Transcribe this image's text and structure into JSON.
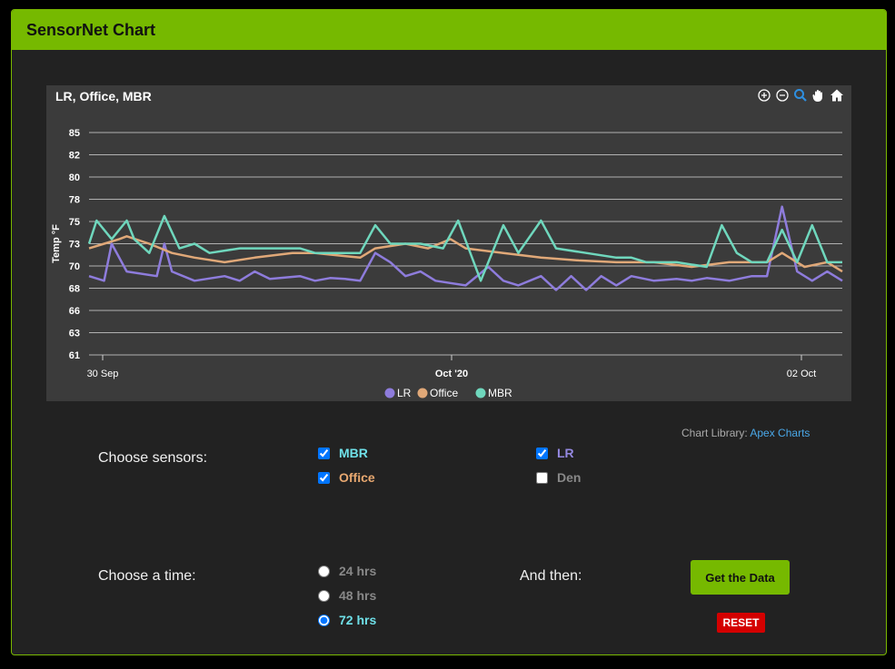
{
  "panel": {
    "title": "SensorNet Chart"
  },
  "chart_data": {
    "type": "line",
    "title": "LR, Office, MBR",
    "ylabel": "Temp °F",
    "xlabel": "",
    "y_ticks": [
      "85",
      "82",
      "80",
      "78",
      "75",
      "73",
      "70",
      "68",
      "66",
      "63",
      "61"
    ],
    "ylim": [
      61,
      85
    ],
    "x_tick_labels": [
      "30 Sep",
      "Oct '20",
      "02 Oct"
    ],
    "legend": [
      "LR",
      "Office",
      "MBR"
    ],
    "legend_position": "bottom",
    "colors": {
      "LR": "#8e7cdc",
      "Office": "#e0a878",
      "MBR": "#6fd7bd"
    },
    "grid": true,
    "series": [
      {
        "name": "LR",
        "x": [
          0,
          2,
          3,
          5,
          9,
          10,
          11,
          14,
          18,
          20,
          22,
          24,
          28,
          30,
          32,
          34,
          36,
          38,
          40,
          42,
          44,
          46,
          50,
          53,
          55,
          57,
          60,
          62,
          64,
          66,
          68,
          70,
          72,
          75,
          78,
          80,
          82,
          85,
          88,
          90,
          92,
          94,
          96,
          98,
          100
        ],
        "values": [
          69.5,
          69,
          73,
          70,
          69.5,
          73,
          70,
          69,
          69.5,
          69,
          70,
          69.2,
          69.5,
          69,
          69.3,
          69.2,
          69,
          72,
          71,
          69.5,
          70,
          69,
          68.5,
          70.5,
          69,
          68.5,
          69.5,
          68,
          69.5,
          68,
          69.5,
          68.5,
          69.5,
          69,
          69.2,
          69,
          69.3,
          69,
          69.5,
          69.5,
          77,
          70,
          69,
          70,
          69
        ]
      },
      {
        "name": "Office",
        "x": [
          0,
          2,
          4,
          5,
          8,
          11,
          14,
          18,
          22,
          27,
          30,
          36,
          38,
          42,
          45,
          48,
          50,
          55,
          60,
          65,
          70,
          75,
          80,
          85,
          90,
          92,
          95,
          98,
          100
        ],
        "values": [
          72.5,
          73,
          73.5,
          73.8,
          73,
          72,
          71.5,
          71,
          71.5,
          72,
          72,
          71.5,
          72.5,
          73,
          72.5,
          73.5,
          72.5,
          72,
          71.5,
          71.2,
          71,
          71,
          70.5,
          71,
          71,
          72,
          70.5,
          71,
          70
        ]
      },
      {
        "name": "MBR",
        "x": [
          0,
          1,
          3,
          5,
          6,
          8,
          10,
          12,
          14,
          16,
          20,
          24,
          28,
          30,
          32,
          36,
          38,
          40,
          44,
          47,
          49,
          52,
          55,
          57,
          60,
          62,
          66,
          70,
          72,
          74,
          78,
          82,
          84,
          86,
          88,
          90,
          92,
          94,
          96,
          98,
          100
        ],
        "values": [
          73,
          75.5,
          73.5,
          75.5,
          73.5,
          72,
          76,
          72.5,
          73,
          72,
          72.5,
          72.5,
          72.5,
          72,
          72,
          72,
          75,
          73,
          73,
          72.5,
          75.5,
          69,
          75,
          72,
          75.5,
          72.5,
          72,
          71.5,
          71.5,
          71,
          71,
          70.5,
          75,
          72,
          71,
          71,
          74.5,
          71,
          75,
          71,
          71
        ]
      }
    ]
  },
  "credit": {
    "prefix": "Chart Library:",
    "link": "Apex Charts"
  },
  "form": {
    "sensors_label": "Choose sensors:",
    "sensors": [
      {
        "label": "MBR",
        "checked": true,
        "color": "#6fe0e8"
      },
      {
        "label": "Office",
        "checked": true,
        "color": "#e8a870"
      },
      {
        "label": "LR",
        "checked": true,
        "color": "#9488e0"
      },
      {
        "label": "Den",
        "checked": false,
        "color": "#888888"
      }
    ],
    "time_label": "Choose a time:",
    "times": [
      {
        "label": "24 hrs",
        "selected": false
      },
      {
        "label": "48 hrs",
        "selected": false
      },
      {
        "label": "72 hrs",
        "selected": true
      }
    ],
    "then_label": "And then:",
    "get_button": "Get the Data",
    "reset_button": "RESET"
  }
}
